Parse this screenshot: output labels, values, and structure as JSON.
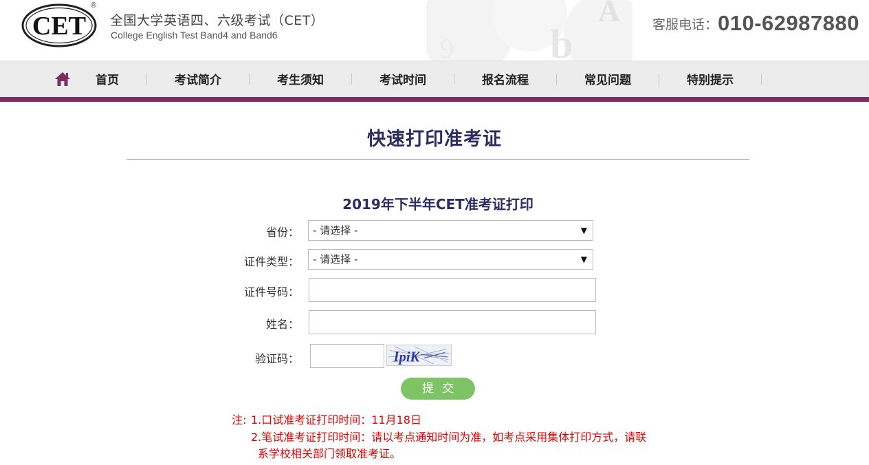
{
  "header": {
    "logo_text": "CET",
    "logo_reg": "®",
    "title_cn": "全国大学英语四、六级考试（CET）",
    "title_en": "College English Test Band4 and Band6",
    "hotline_label": "客服电话：",
    "hotline_number": "010-62987880"
  },
  "nav": {
    "home_icon": "home-icon",
    "items": [
      {
        "label": "首页"
      },
      {
        "label": "考试简介"
      },
      {
        "label": "考生须知"
      },
      {
        "label": "考试时间"
      },
      {
        "label": "报名流程"
      },
      {
        "label": "常见问题"
      },
      {
        "label": "特别提示"
      }
    ]
  },
  "page": {
    "title": "快速打印准考证",
    "form_title": "2019年下半年CET准考证打印"
  },
  "form": {
    "province_label": "省份：",
    "province_value": "- 请选择 -",
    "idtype_label": "证件类型：",
    "idtype_value": "- 请选择 -",
    "idnumber_label": "证件号码：",
    "idnumber_value": "",
    "name_label": "姓名：",
    "name_value": "",
    "captcha_label": "验证码：",
    "captcha_value": "",
    "captcha_text": "IpiK",
    "submit_label": "提交"
  },
  "notes": {
    "prefix": "注:",
    "line1": "1.口试准考证打印时间：11月18日",
    "line2": "2.笔试准考证打印时间：请以考点通知时间为准，如考点采用集体打印方式，请联",
    "line3": "系学校相关部门领取准考证。"
  },
  "colors": {
    "accent_bar": "#7a2e64",
    "title": "#2b2c60",
    "submit": "#7dc464",
    "note": "#e00000"
  }
}
